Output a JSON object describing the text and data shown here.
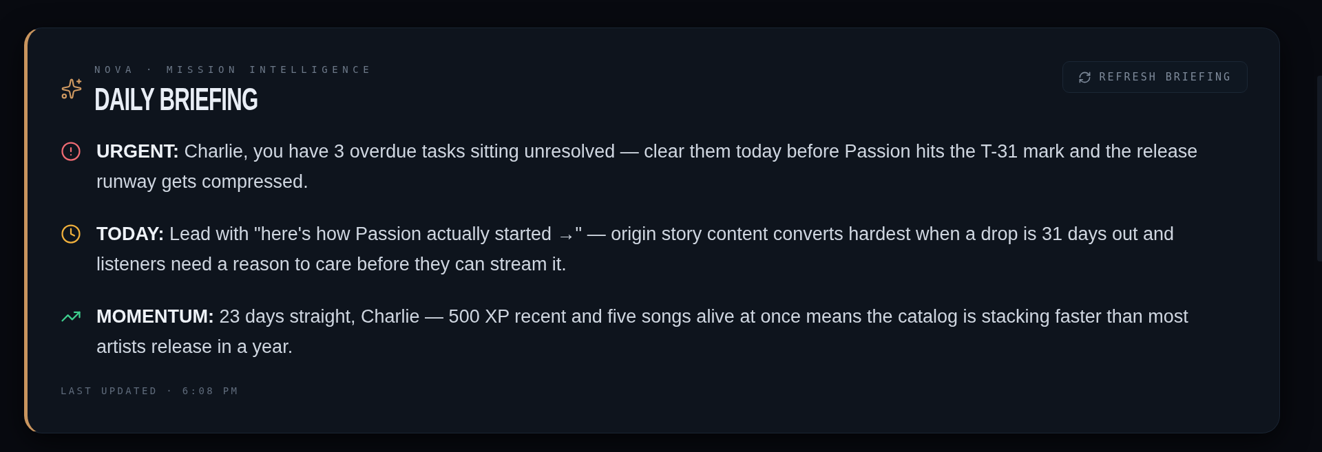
{
  "header": {
    "eyebrow": "NOVA · MISSION INTELLIGENCE",
    "title": "DAILY BRIEFING",
    "refresh_button": "REFRESH BRIEFING"
  },
  "items": [
    {
      "kind": "urgent",
      "color": "#ef6b73",
      "text": "**URGENT:** Charlie, you have 3 overdue tasks sitting unresolved — clear them today before Passion hits the T-31 mark and the release runway gets compressed."
    },
    {
      "kind": "today",
      "color": "#f0b03c",
      "text": "**TODAY:** Lead with \"here's how Passion actually started →\" — origin story content converts hardest when a drop is 31 days out and listeners need a reason to care before they can stream it."
    },
    {
      "kind": "momentum",
      "color": "#3ecf8e",
      "text": "**MOMENTUM:** 23 days straight, Charlie — 500 XP recent and five songs alive at once means the catalog is stacking faster than most artists release in a year."
    }
  ],
  "footer": {
    "last_updated": "LAST UPDATED · 6:08 PM"
  }
}
